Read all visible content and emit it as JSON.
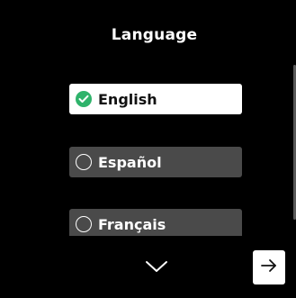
{
  "header": {
    "title": "Language"
  },
  "languages": [
    {
      "label": "English",
      "selected": true
    },
    {
      "label": "Español",
      "selected": false
    },
    {
      "label": "Français",
      "selected": false
    }
  ],
  "icons": {
    "selected": "check-circle-icon",
    "unselected": "radio-empty-icon",
    "scroll_down": "chevron-down-icon",
    "next": "arrow-right-icon"
  },
  "colors": {
    "background": "#000000",
    "selected_background": "#ffffff",
    "unselected_background": "#4a4a4a",
    "check": "#2fb36b"
  }
}
